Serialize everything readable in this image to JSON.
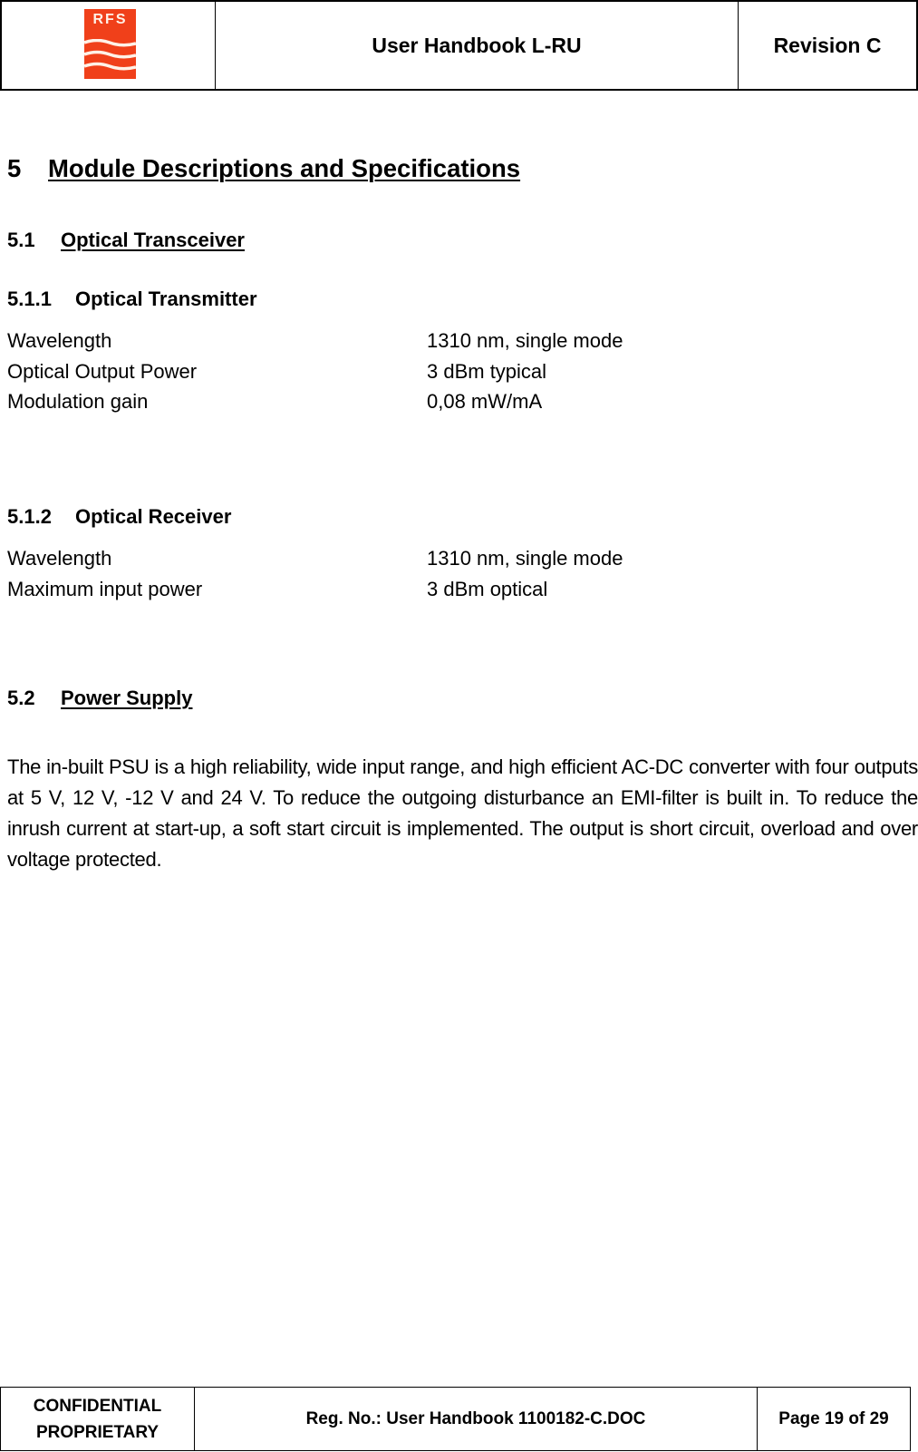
{
  "header": {
    "logo_text": "RFS",
    "logo_color": "#f0401a",
    "title": "User Handbook L-RU",
    "revision": "Revision C"
  },
  "section": {
    "number": "5",
    "title": "Module Descriptions and Specifications",
    "subsections": [
      {
        "number": "5.1",
        "title": "Optical Transceiver",
        "subsubsections": [
          {
            "number": "5.1.1",
            "title": "Optical Transmitter",
            "specs": [
              {
                "label": "Wavelength",
                "value": "1310 nm, single mode"
              },
              {
                "label": "Optical Output Power",
                "value": "3 dBm typical"
              },
              {
                "label": "Modulation gain",
                "value": "0,08 mW/mA"
              }
            ]
          },
          {
            "number": "5.1.2",
            "title": "Optical Receiver",
            "specs": [
              {
                "label": "Wavelength",
                "value": "1310 nm, single mode"
              },
              {
                "label": "Maximum input power",
                "value": "3 dBm optical"
              }
            ]
          }
        ]
      },
      {
        "number": "5.2",
        "title": "Power Supply",
        "paragraph": "The in-built PSU is a high reliability, wide input range, and high efficient AC-DC converter with four outputs at 5 V, 12 V, -12 V and 24 V. To reduce the outgoing disturbance an EMI-filter is built in. To reduce the inrush current at start-up, a soft start circuit is implemented. The output is short circuit, overload and over voltage protected."
      }
    ]
  },
  "footer": {
    "classification_line1": "CONFIDENTIAL",
    "classification_line2": "PROPRIETARY",
    "reg_no": "Reg. No.: User Handbook 1100182-C.DOC",
    "page": "Page 19 of 29"
  }
}
